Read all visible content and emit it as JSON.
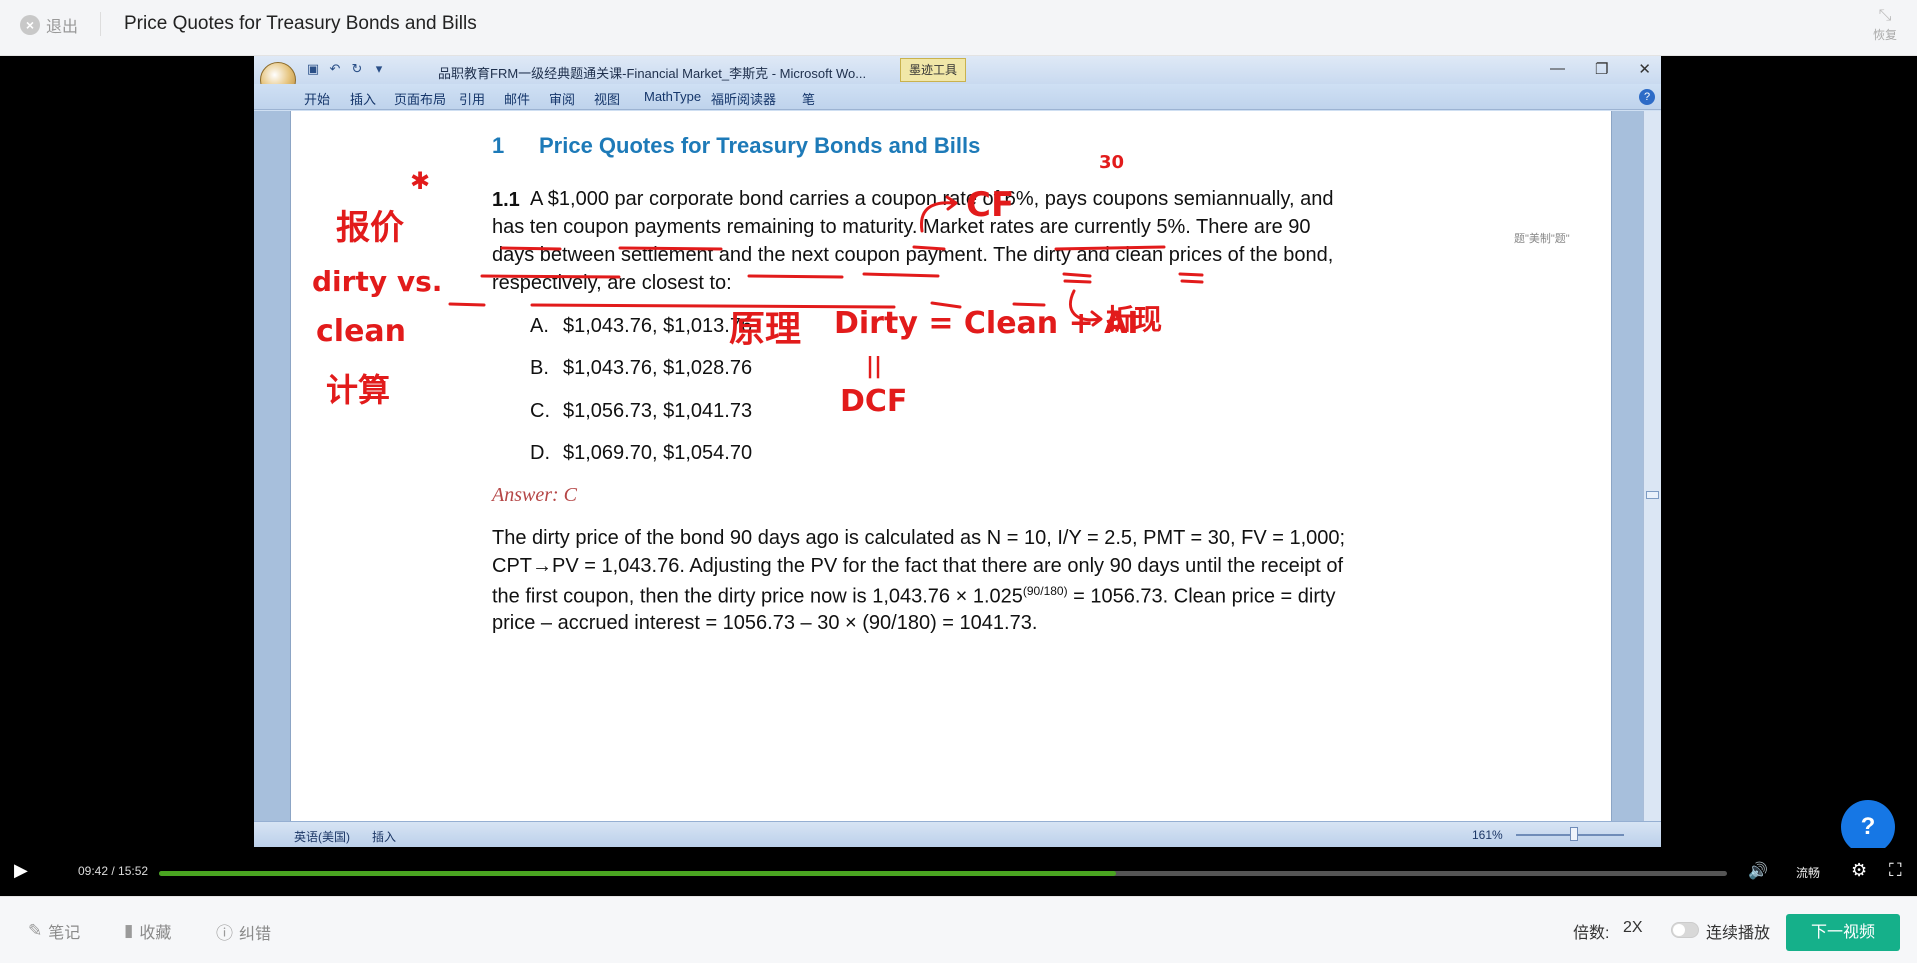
{
  "topbar": {
    "exit_label": "退出",
    "title": "Price Quotes for Treasury Bonds and Bills",
    "restore_label": "恢复"
  },
  "word": {
    "doc_title": "品职教育FRM一级经典题通关课-Financial Market_李斯克 - Microsoft Wo...",
    "ink_tools": "墨迹工具",
    "tabs": [
      "开始",
      "插入",
      "页面布局",
      "引用",
      "邮件",
      "审阅",
      "视图",
      "MathType",
      "福昕阅读器",
      "笔"
    ],
    "status_lang": "英语(美国)",
    "status_mode": "插入",
    "zoom": "161%"
  },
  "document": {
    "section_number": "1",
    "section_title": "Price Quotes for Treasury Bonds and Bills",
    "question_number": "1.1",
    "question_lines": [
      "A $1,000 par corporate bond carries a coupon rate of 6%, pays coupons semiannually, and",
      "has ten coupon payments remaining to maturity. Market rates are currently 5%. There are 90",
      "days between settlement and the next coupon payment. The dirty and clean prices of the bond,",
      "respectively, are closest to:"
    ],
    "options": [
      {
        "letter": "A.",
        "text": "$1,043.76, $1,013.76"
      },
      {
        "letter": "B.",
        "text": "$1,043.76, $1,028.76"
      },
      {
        "letter": "C.",
        "text": "$1,056.73, $1,041.73"
      },
      {
        "letter": "D.",
        "text": "$1,069.70, $1,054.70"
      }
    ],
    "answer": "Answer: C",
    "explanation_lines": [
      "The dirty price of the bond 90 days ago is calculated as N = 10, I/Y = 2.5, PMT = 30, FV = 1,000;",
      "CPT→PV = 1,043.76. Adjusting the PV for the fact that there are only 90 days until the receipt of",
      "the first coupon, then the dirty price now is 1,043.76 × 1.025",
      "price – accrued interest = 1056.73 – 30 × (90/180) = 1041.73."
    ],
    "explanation_superscript": "(90/180)",
    "explanation_line3_tail": " = 1056.73. Clean price = dirty",
    "annotations": {
      "cf": "CF",
      "thirty": "30",
      "baojia": "报价",
      "dirty_vs": "dirty vs.",
      "clean": "clean",
      "jisuan": "计算",
      "yuanli": "原理",
      "zhexian": "折现",
      "formula": "Dirty = Clean + AI",
      "equals": "||",
      "dcf": "DCF"
    }
  },
  "side_note": "题\"美制\"题\"",
  "player": {
    "time": "09:42 / 15:52",
    "progress": 0.6104,
    "quality": "流畅"
  },
  "bottombar": {
    "note_label": "笔记",
    "collect_label": "收藏",
    "report_label": "纠错",
    "speed_label": "倍数:",
    "speed_value": "2X",
    "autoplay_label": "连续播放",
    "next_label": "下一视频"
  },
  "colors": {
    "accent_green": "#15b08a",
    "progress_green": "#4aa521",
    "heading_blue": "#1d7ab8",
    "ink_red": "#e21b1b",
    "help_blue": "#1677e5"
  }
}
